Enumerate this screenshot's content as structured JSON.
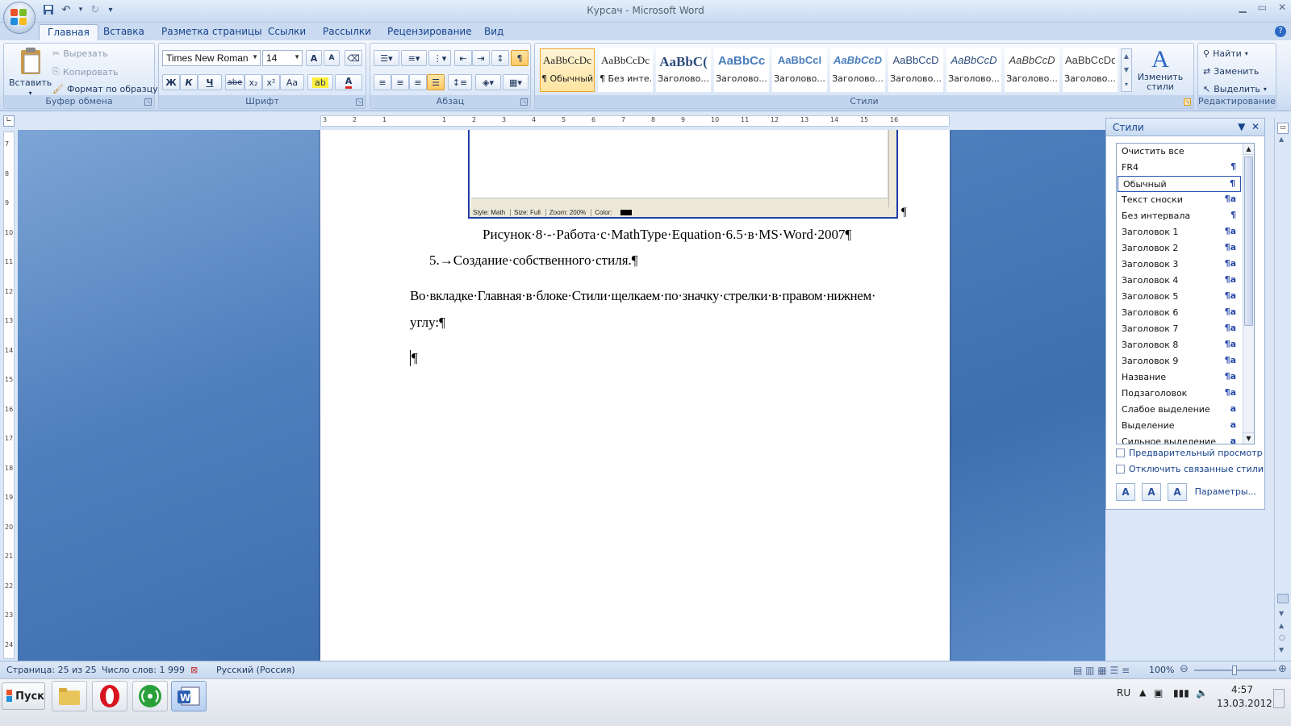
{
  "window": {
    "title": "Курсач - Microsoft Word",
    "minimize": "▁",
    "maximize": "▭",
    "close": "✕"
  },
  "qat": {
    "save": "save-icon",
    "undo": "undo-icon",
    "redo": "redo-icon",
    "customize": "▾"
  },
  "tabs": [
    "Главная",
    "Вставка",
    "Разметка страницы",
    "Ссылки",
    "Рассылки",
    "Рецензирование",
    "Вид"
  ],
  "ribbon": {
    "clipboard": {
      "label": "Буфер обмена",
      "paste": "Вставить",
      "cut": "Вырезать",
      "copy": "Копировать",
      "format_painter": "Формат по образцу"
    },
    "font": {
      "label": "Шрифт",
      "font_name": "Times New Roman",
      "font_size": "14",
      "bold": "Ж",
      "italic": "К",
      "underline": "Ч",
      "strike": "abe",
      "subscript": "x₂",
      "superscript": "x²",
      "change_case": "Aa",
      "grow": "A",
      "shrink": "A",
      "font_color": "A"
    },
    "paragraph": {
      "label": "Абзац",
      "pilcrow": "¶"
    },
    "styles": {
      "label": "Стили",
      "gallery": [
        {
          "preview": "AaBbCcDc",
          "name": "¶ Обычный"
        },
        {
          "preview": "AaBbCcDc",
          "name": "¶ Без инте..."
        },
        {
          "preview": "AaBbC(",
          "name": "Заголово..."
        },
        {
          "preview": "AaBbCc",
          "name": "Заголово..."
        },
        {
          "preview": "AaBbCcI",
          "name": "Заголово..."
        },
        {
          "preview": "AaBbCcD",
          "name": "Заголово..."
        },
        {
          "preview": "AaBbCcD",
          "name": "Заголово..."
        },
        {
          "preview": "AaBbCcD",
          "name": "Заголово..."
        },
        {
          "preview": "AaBbCcD",
          "name": "Заголово..."
        },
        {
          "preview": "AaBbCcDd",
          "name": "Заголово..."
        }
      ],
      "change_styles": "Изменить стили"
    },
    "editing": {
      "label": "Редактирование",
      "find": "Найти",
      "replace": "Заменить",
      "select": "Выделить"
    }
  },
  "document": {
    "embed_status": [
      "Style: Math",
      "Size: Full",
      "Zoom: 200%",
      "Color:"
    ],
    "caption": "Рисунок·8·-·Работа·с·MathType·Equation·6.5·в·MS·Word·2007¶",
    "heading": "5.→Создание·собственного·стиля.¶",
    "para_line1": "Во·вкладке·Главная·в·блоке·Стили·щелкаем·по·значку·стрелки·в·правом·нижнем·",
    "para_line2": "углу:¶",
    "empty_para": "¶",
    "embed_pilcrow": "¶"
  },
  "ruler_h": [
    "3",
    "2",
    "1",
    "",
    "1",
    "2",
    "3",
    "4",
    "5",
    "6",
    "7",
    "8",
    "9",
    "10",
    "11",
    "12",
    "13",
    "14",
    "15",
    "16"
  ],
  "ruler_v": [
    "7",
    "8",
    "9",
    "10",
    "11",
    "12",
    "13",
    "14",
    "15",
    "16",
    "17",
    "18",
    "19",
    "20",
    "21",
    "22",
    "23",
    "24"
  ],
  "styles_pane": {
    "title": "Стили",
    "items": [
      {
        "name": "Очистить все",
        "mark": ""
      },
      {
        "name": "FR4",
        "mark": "¶"
      },
      {
        "name": "Обычный",
        "mark": "¶"
      },
      {
        "name": "Текст сноски",
        "mark": "¶a"
      },
      {
        "name": "Без интервала",
        "mark": "¶"
      },
      {
        "name": "Заголовок 1",
        "mark": "¶a"
      },
      {
        "name": "Заголовок 2",
        "mark": "¶a"
      },
      {
        "name": "Заголовок 3",
        "mark": "¶a"
      },
      {
        "name": "Заголовок 4",
        "mark": "¶a"
      },
      {
        "name": "Заголовок 5",
        "mark": "¶a"
      },
      {
        "name": "Заголовок 6",
        "mark": "¶a"
      },
      {
        "name": "Заголовок 7",
        "mark": "¶a"
      },
      {
        "name": "Заголовок 8",
        "mark": "¶a"
      },
      {
        "name": "Заголовок 9",
        "mark": "¶a"
      },
      {
        "name": "Название",
        "mark": "¶a"
      },
      {
        "name": "Подзаголовок",
        "mark": "¶a"
      },
      {
        "name": "Слабое выделение",
        "mark": "a"
      },
      {
        "name": "Выделение",
        "mark": "a"
      },
      {
        "name": "Сильное выделение",
        "mark": "a"
      }
    ],
    "preview_option": "Предварительный просмотр",
    "linked_option": "Отключить связанные стили",
    "parameters": "Параметры..."
  },
  "statusbar": {
    "page": "Страница: 25 из 25",
    "words": "Число слов: 1 999",
    "language": "Русский (Россия)",
    "zoom": "100%"
  },
  "taskbar": {
    "start": "Пуск",
    "lang": "RU",
    "time": "4:57",
    "date": "13.03.2012"
  }
}
